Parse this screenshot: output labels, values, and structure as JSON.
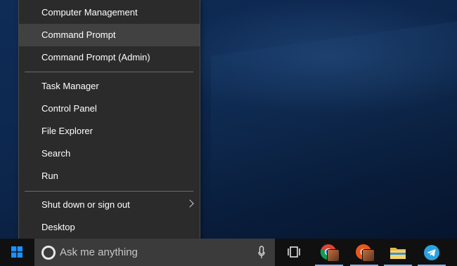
{
  "menu": {
    "items": [
      {
        "label": "Computer Management",
        "hover": false
      },
      {
        "label": "Command Prompt",
        "hover": true
      },
      {
        "label": "Command Prompt (Admin)",
        "hover": false
      },
      {
        "label": "Task Manager",
        "hover": false
      },
      {
        "label": "Control Panel",
        "hover": false
      },
      {
        "label": "File Explorer",
        "hover": false
      },
      {
        "label": "Search",
        "hover": false
      },
      {
        "label": "Run",
        "hover": false
      },
      {
        "label": "Shut down or sign out",
        "hover": false,
        "submenu": true
      },
      {
        "label": "Desktop",
        "hover": false
      }
    ]
  },
  "taskbar": {
    "search": {
      "placeholder": "Ask me anything",
      "icon": "cortana-icon",
      "mic_icon": "microphone-icon"
    },
    "start_icon": "windows-logo-icon",
    "buttons": [
      {
        "name": "task-view",
        "icon": "task-view-icon",
        "open": false
      },
      {
        "name": "chrome",
        "icon": "chrome-icon",
        "open": true
      },
      {
        "name": "chrome-profile",
        "icon": "chrome-profile-icon",
        "open": true
      },
      {
        "name": "file-explorer",
        "icon": "folder-icon",
        "open": true
      },
      {
        "name": "telegram",
        "icon": "telegram-icon",
        "open": true
      }
    ]
  },
  "colors": {
    "menu_bg": "#2b2b2b",
    "menu_hover": "#414141",
    "taskbar_bg": "#101010",
    "search_bg": "#3b3b3b",
    "windows_blue": "#1e90ff"
  }
}
